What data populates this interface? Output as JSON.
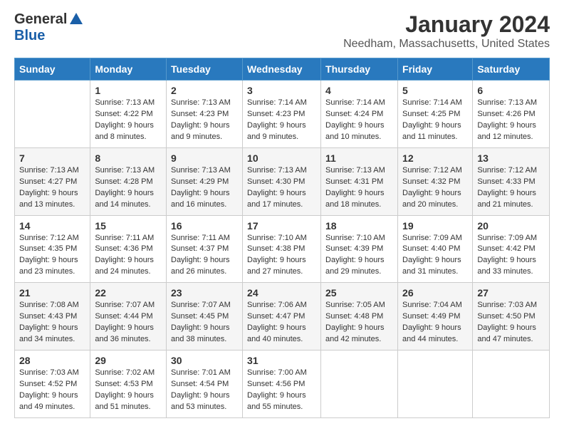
{
  "logo": {
    "general": "General",
    "blue": "Blue"
  },
  "title": "January 2024",
  "location": "Needham, Massachusetts, United States",
  "headers": [
    "Sunday",
    "Monday",
    "Tuesday",
    "Wednesday",
    "Thursday",
    "Friday",
    "Saturday"
  ],
  "weeks": [
    [
      {
        "day": "",
        "info": ""
      },
      {
        "day": "1",
        "info": "Sunrise: 7:13 AM\nSunset: 4:22 PM\nDaylight: 9 hours\nand 8 minutes."
      },
      {
        "day": "2",
        "info": "Sunrise: 7:13 AM\nSunset: 4:23 PM\nDaylight: 9 hours\nand 9 minutes."
      },
      {
        "day": "3",
        "info": "Sunrise: 7:14 AM\nSunset: 4:23 PM\nDaylight: 9 hours\nand 9 minutes."
      },
      {
        "day": "4",
        "info": "Sunrise: 7:14 AM\nSunset: 4:24 PM\nDaylight: 9 hours\nand 10 minutes."
      },
      {
        "day": "5",
        "info": "Sunrise: 7:14 AM\nSunset: 4:25 PM\nDaylight: 9 hours\nand 11 minutes."
      },
      {
        "day": "6",
        "info": "Sunrise: 7:13 AM\nSunset: 4:26 PM\nDaylight: 9 hours\nand 12 minutes."
      }
    ],
    [
      {
        "day": "7",
        "info": "Sunrise: 7:13 AM\nSunset: 4:27 PM\nDaylight: 9 hours\nand 13 minutes."
      },
      {
        "day": "8",
        "info": "Sunrise: 7:13 AM\nSunset: 4:28 PM\nDaylight: 9 hours\nand 14 minutes."
      },
      {
        "day": "9",
        "info": "Sunrise: 7:13 AM\nSunset: 4:29 PM\nDaylight: 9 hours\nand 16 minutes."
      },
      {
        "day": "10",
        "info": "Sunrise: 7:13 AM\nSunset: 4:30 PM\nDaylight: 9 hours\nand 17 minutes."
      },
      {
        "day": "11",
        "info": "Sunrise: 7:13 AM\nSunset: 4:31 PM\nDaylight: 9 hours\nand 18 minutes."
      },
      {
        "day": "12",
        "info": "Sunrise: 7:12 AM\nSunset: 4:32 PM\nDaylight: 9 hours\nand 20 minutes."
      },
      {
        "day": "13",
        "info": "Sunrise: 7:12 AM\nSunset: 4:33 PM\nDaylight: 9 hours\nand 21 minutes."
      }
    ],
    [
      {
        "day": "14",
        "info": "Sunrise: 7:12 AM\nSunset: 4:35 PM\nDaylight: 9 hours\nand 23 minutes."
      },
      {
        "day": "15",
        "info": "Sunrise: 7:11 AM\nSunset: 4:36 PM\nDaylight: 9 hours\nand 24 minutes."
      },
      {
        "day": "16",
        "info": "Sunrise: 7:11 AM\nSunset: 4:37 PM\nDaylight: 9 hours\nand 26 minutes."
      },
      {
        "day": "17",
        "info": "Sunrise: 7:10 AM\nSunset: 4:38 PM\nDaylight: 9 hours\nand 27 minutes."
      },
      {
        "day": "18",
        "info": "Sunrise: 7:10 AM\nSunset: 4:39 PM\nDaylight: 9 hours\nand 29 minutes."
      },
      {
        "day": "19",
        "info": "Sunrise: 7:09 AM\nSunset: 4:40 PM\nDaylight: 9 hours\nand 31 minutes."
      },
      {
        "day": "20",
        "info": "Sunrise: 7:09 AM\nSunset: 4:42 PM\nDaylight: 9 hours\nand 33 minutes."
      }
    ],
    [
      {
        "day": "21",
        "info": "Sunrise: 7:08 AM\nSunset: 4:43 PM\nDaylight: 9 hours\nand 34 minutes."
      },
      {
        "day": "22",
        "info": "Sunrise: 7:07 AM\nSunset: 4:44 PM\nDaylight: 9 hours\nand 36 minutes."
      },
      {
        "day": "23",
        "info": "Sunrise: 7:07 AM\nSunset: 4:45 PM\nDaylight: 9 hours\nand 38 minutes."
      },
      {
        "day": "24",
        "info": "Sunrise: 7:06 AM\nSunset: 4:47 PM\nDaylight: 9 hours\nand 40 minutes."
      },
      {
        "day": "25",
        "info": "Sunrise: 7:05 AM\nSunset: 4:48 PM\nDaylight: 9 hours\nand 42 minutes."
      },
      {
        "day": "26",
        "info": "Sunrise: 7:04 AM\nSunset: 4:49 PM\nDaylight: 9 hours\nand 44 minutes."
      },
      {
        "day": "27",
        "info": "Sunrise: 7:03 AM\nSunset: 4:50 PM\nDaylight: 9 hours\nand 47 minutes."
      }
    ],
    [
      {
        "day": "28",
        "info": "Sunrise: 7:03 AM\nSunset: 4:52 PM\nDaylight: 9 hours\nand 49 minutes."
      },
      {
        "day": "29",
        "info": "Sunrise: 7:02 AM\nSunset: 4:53 PM\nDaylight: 9 hours\nand 51 minutes."
      },
      {
        "day": "30",
        "info": "Sunrise: 7:01 AM\nSunset: 4:54 PM\nDaylight: 9 hours\nand 53 minutes."
      },
      {
        "day": "31",
        "info": "Sunrise: 7:00 AM\nSunset: 4:56 PM\nDaylight: 9 hours\nand 55 minutes."
      },
      {
        "day": "",
        "info": ""
      },
      {
        "day": "",
        "info": ""
      },
      {
        "day": "",
        "info": ""
      }
    ]
  ]
}
